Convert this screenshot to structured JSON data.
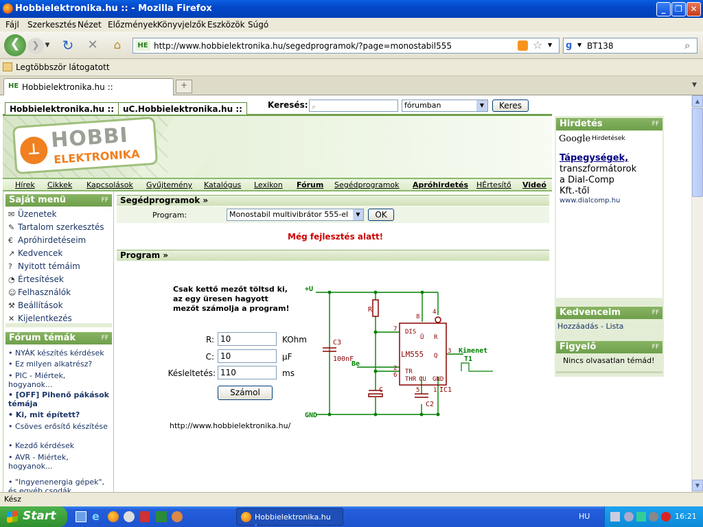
{
  "window": {
    "title": "Hobbielektronika.hu :: - Mozilla Firefox"
  },
  "menu": [
    "Fájl",
    "Szerkesztés",
    "Nézet",
    "Előzmények",
    "Könyvjelzők",
    "Eszközök",
    "Súgó"
  ],
  "address": {
    "url": "http://www.hobbielektronika.hu/segedprogramok/?page=monostabil555",
    "favicon": "HE"
  },
  "search": {
    "value": "BT138"
  },
  "bookmarks": {
    "item": "Legtöbbször látogatott"
  },
  "browser_tab": {
    "label": "Hobbielektronika.hu ::"
  },
  "site_tabs": [
    "Hobbielektronika.hu ::",
    "uC.Hobbielektronika.hu ::"
  ],
  "site_search": {
    "label": "Keresés:",
    "scope": "fórumban",
    "button": "Keres"
  },
  "logo": {
    "line1": "HOBBI",
    "line2": "ELEKTRONIKA"
  },
  "topnav": [
    "Hírek",
    "Cikkek",
    "Kapcsolások",
    "Gyűjtemény",
    "Katalógus",
    "Lexikon",
    "Fórum",
    "Segédprogramok",
    "Apróhirdetés",
    "HÉrtesítő",
    "Videó"
  ],
  "my_menu": {
    "title": "Saját menü",
    "items": [
      {
        "label": "Üzenetek",
        "icon": "envelope-icon",
        "glyph": "✉"
      },
      {
        "label": "Tartalom szerkesztés",
        "icon": "edit-icon",
        "glyph": "✎"
      },
      {
        "label": "Apróhirdetéseim",
        "icon": "ads-icon",
        "glyph": "€"
      },
      {
        "label": "Kedvencek",
        "icon": "favorites-icon",
        "glyph": "↗"
      },
      {
        "label": "Nyitott témáim",
        "icon": "question-icon",
        "glyph": "?"
      },
      {
        "label": "Értesítések",
        "icon": "notification-icon",
        "glyph": "◔"
      },
      {
        "label": "Felhasználók",
        "icon": "users-icon",
        "glyph": "☺"
      },
      {
        "label": "Beállítások",
        "icon": "tools-icon",
        "glyph": "⚒"
      },
      {
        "label": "Kijelentkezés",
        "icon": "logout-icon",
        "glyph": "✕"
      }
    ]
  },
  "forum": {
    "title": "Fórum témák",
    "items": [
      {
        "label": "NYÁK készítés kérdések",
        "bold": false
      },
      {
        "label": "Ez milyen alkatrész?",
        "bold": false
      },
      {
        "label": "PIC - Miértek, hogyanok...",
        "bold": false
      },
      {
        "label": "[OFF] Pihenő pákások témája",
        "bold": true
      },
      {
        "label": "Ki, mit épített?",
        "bold": true
      },
      {
        "label": "Csöves erősítő készítése",
        "bold": false
      },
      {
        "label": "Kezdő kérdések",
        "bold": false
      },
      {
        "label": "AVR - Miértek, hogyanok...",
        "bold": false
      },
      {
        "label": "\"Ingyenenergia gépek\", és egyéb csodák",
        "bold": false
      }
    ]
  },
  "segedprogramok": {
    "title": "Segédprogramok »",
    "program_label": "Program:",
    "program_value": "Monostabil multivibrátor 555-el",
    "ok": "OK",
    "warning": "Még fejlesztés alatt!"
  },
  "program": {
    "title": "Program »",
    "instruction": "Csak kettő mezőt töltsd ki, az egy üresen hagyott mezőt számolja a program!",
    "fields": [
      {
        "label": "R:",
        "value": "10",
        "unit": "KOhm"
      },
      {
        "label": "C:",
        "value": "10",
        "unit": "µF"
      },
      {
        "label": "Késleltetés:",
        "value": "110",
        "unit": "ms"
      }
    ],
    "calc_button": "Számol",
    "footer_url": "http://www.hobbielektronika.hu/"
  },
  "schematic": {
    "vplus": "+U",
    "gnd": "GND",
    "r": "R",
    "c": "C",
    "c2": "C2",
    "c3": "C3",
    "c3_val": "100nF",
    "ic": "IC1",
    "chip": "LM555",
    "be": "Be",
    "out": "Kimenet",
    "t1": "T1",
    "pins": [
      "DIS",
      "Ū",
      "TR",
      "THR",
      "CU",
      "GND",
      "R",
      "Q"
    ],
    "pin_nums": [
      "4",
      "8",
      "7",
      "2",
      "6",
      "5",
      "1",
      "3"
    ],
    "colors": {
      "wire": "#008000",
      "part": "#8b0000"
    }
  },
  "right": {
    "ads_title": "Hirdetés",
    "google": "Google",
    "google_sub": "Hirdetések",
    "ad_title": "Tápegységek,",
    "ad_lines": [
      "transzformátorok",
      "a Dial-Comp",
      "Kft.-től"
    ],
    "ad_url": "www.dialcomp.hu",
    "fav_title": "Kedvenceim",
    "fav_links": "Hozzáadás - Lista",
    "watch_title": "Figyelő",
    "watch_text": "Nincs olvasatlan témád!"
  },
  "status": {
    "text": "Kész"
  },
  "taskbar": {
    "start": "Start",
    "task": "Hobbielektronika.hu :...",
    "lang": "HU",
    "clock": "16:21"
  },
  "colors": {
    "accent_green": "#6f9f4c",
    "warning_red": "#cc0000",
    "link_blue": "#1a3566"
  }
}
